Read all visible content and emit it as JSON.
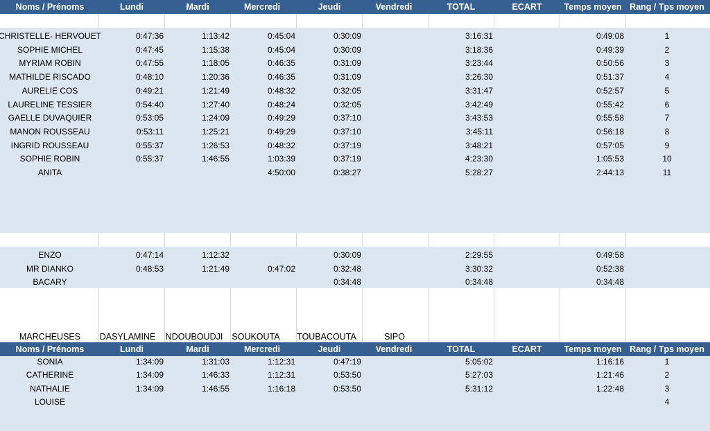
{
  "header_labels": [
    "Noms / Prénoms",
    "Lundi",
    "Mardi",
    "Mercredi",
    "Jeudi",
    "Vendredi",
    "TOTAL",
    "ECART",
    "Temps moyen",
    "Rang / Tps moyen"
  ],
  "group1": [
    {
      "name": "CHRISTELLE- HERVOUET",
      "lundi": "0:47:36",
      "mardi": "1:13:42",
      "mercredi": "0:45:04",
      "jeudi": "0:30:09",
      "total": "3:16:31",
      "moyen": "0:49:08",
      "rang": "1"
    },
    {
      "name": "SOPHIE MICHEL",
      "lundi": "0:47:45",
      "mardi": "1:15:38",
      "mercredi": "0:45:04",
      "jeudi": "0:30:09",
      "total": "3:18:36",
      "moyen": "0:49:39",
      "rang": "2"
    },
    {
      "name": "MYRIAM ROBIN",
      "lundi": "0:47:55",
      "mardi": "1:18:05",
      "mercredi": "0:46:35",
      "jeudi": "0:31:09",
      "total": "3:23:44",
      "moyen": "0:50:56",
      "rang": "3"
    },
    {
      "name": "MATHILDE RISCADO",
      "lundi": "0:48:10",
      "mardi": "1:20:36",
      "mercredi": "0:46:35",
      "jeudi": "0:31:09",
      "total": "3:26:30",
      "moyen": "0:51:37",
      "rang": "4"
    },
    {
      "name": "AURELIE COS",
      "lundi": "0:49:21",
      "mardi": "1:21:49",
      "mercredi": "0:48:32",
      "jeudi": "0:32:05",
      "total": "3:31:47",
      "moyen": "0:52:57",
      "rang": "5"
    },
    {
      "name": "LAURELINE  TESSIER",
      "lundi": "0:54:40",
      "mardi": "1:27:40",
      "mercredi": "0:48:24",
      "jeudi": "0:32:05",
      "total": "3:42:49",
      "moyen": "0:55:42",
      "rang": "6"
    },
    {
      "name": "GAELLE DUVAQUIER",
      "lundi": "0:53:05",
      "mardi": "1:24:09",
      "mercredi": "0:49:29",
      "jeudi": "0:37:10",
      "total": "3:43:53",
      "moyen": "0:55:58",
      "rang": "7"
    },
    {
      "name": "MANON ROUSSEAU",
      "lundi": "0:53:11",
      "mardi": "1:25:21",
      "mercredi": "0:49:29",
      "jeudi": "0:37:10",
      "total": "3:45:11",
      "moyen": "0:56:18",
      "rang": "8"
    },
    {
      "name": "INGRID ROUSSEAU",
      "lundi": "0:55:37",
      "mardi": "1:26:53",
      "mercredi": "0:48:32",
      "jeudi": "0:37:19",
      "total": "3:48:21",
      "moyen": "0:57:05",
      "rang": "9"
    },
    {
      "name": "SOPHIE ROBIN",
      "lundi": "0:55:37",
      "mardi": "1:46:55",
      "mercredi": "1:03:39",
      "jeudi": "0:37:19",
      "total": "4:23:30",
      "moyen": "1:05:53",
      "rang": "10"
    },
    {
      "name": "ANITA",
      "lundi": "",
      "mardi": "",
      "mercredi": "4:50:00",
      "jeudi": "0:38:27",
      "total": "5:28:27",
      "moyen": "2:44:13",
      "rang": "11"
    }
  ],
  "group2": [
    {
      "name": "ENZO",
      "lundi": "0:47:14",
      "mardi": "1:12:32",
      "mercredi": "",
      "jeudi": "0:30:09",
      "total": "2:29:55",
      "moyen": "0:49:58",
      "rang": ""
    },
    {
      "name": "MR DIANKO",
      "lundi": "0:48:53",
      "mardi": "1:21:49",
      "mercredi": "0:47:02",
      "jeudi": "0:32:48",
      "total": "3:30:32",
      "moyen": "0:52:38",
      "rang": ""
    },
    {
      "name": "BACARY",
      "lundi": "",
      "mardi": "",
      "mercredi": "",
      "jeudi": "0:34:48",
      "total": "0:34:48",
      "moyen": "0:34:48",
      "rang": ""
    }
  ],
  "marcheuses": [
    "MARCHEUSES",
    "DASYLAMINE",
    "NDOUBOUDJI",
    "SOUKOUTA",
    "TOUBACOUTA",
    "SIPO"
  ],
  "group3": [
    {
      "name": "SONIA",
      "lundi": "1:34:09",
      "mardi": "1:31:03",
      "mercredi": "1:12:31",
      "jeudi": "0:47:19",
      "total": "5:05:02",
      "moyen": "1:16:16",
      "rang": "1"
    },
    {
      "name": "CATHERINE",
      "lundi": "1:34:09",
      "mardi": "1:46:33",
      "mercredi": "1:12:31",
      "jeudi": "0:53:50",
      "total": "5:27:03",
      "moyen": "1:21:46",
      "rang": "2"
    },
    {
      "name": "NATHALIE",
      "lundi": "1:34:09",
      "mardi": "1:46:55",
      "mercredi": "1:16:18",
      "jeudi": "0:53:50",
      "total": "5:31:12",
      "moyen": "1:22:48",
      "rang": "3"
    },
    {
      "name": "LOUISE",
      "lundi": "",
      "mardi": "",
      "mercredi": "",
      "jeudi": "",
      "total": "",
      "moyen": "",
      "rang": "4"
    }
  ]
}
